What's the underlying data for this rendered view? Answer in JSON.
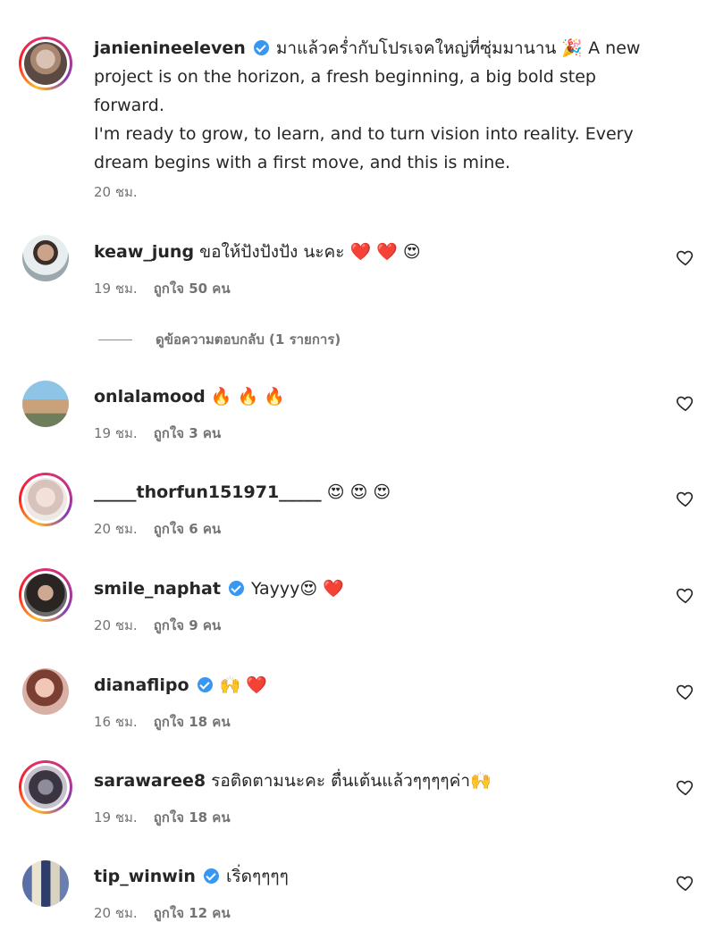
{
  "caption": {
    "username": "janienineeleven",
    "verified": true,
    "text": "มาแล้วคร่ำกับโปรเจคใหญ่ที่ซุ่มมานาน 🎉 A new project is on the horizon, a fresh beginning, a big bold step forward.\nI'm ready to grow, to learn, and to turn vision into reality. Every dream begins with a first move, and this is mine.",
    "time": "20 ชม."
  },
  "view_replies": "ดูข้อความตอบกลับ (1 รายการ)",
  "comments": [
    {
      "username": "keaw_jung",
      "verified": false,
      "text": "ขอให้ปังปังปัง นะคะ ❤️ ❤️ 😍",
      "time": "19 ชม.",
      "likes": "ถูกใจ 50 คน"
    },
    {
      "username": "onlalamood",
      "verified": false,
      "text": "🔥 🔥 🔥",
      "time": "19 ชม.",
      "likes": "ถูกใจ 3 คน"
    },
    {
      "username": "_____thorfun151971_____",
      "verified": false,
      "text": "😍 😍 😍",
      "time": "20 ชม.",
      "likes": "ถูกใจ 6 คน"
    },
    {
      "username": "smile_naphat",
      "verified": true,
      "text": "Yayyy😍 ❤️",
      "time": "20 ชม.",
      "likes": "ถูกใจ 9 คน"
    },
    {
      "username": "dianaflipo",
      "verified": true,
      "text": "🙌 ❤️",
      "time": "16 ชม.",
      "likes": "ถูกใจ 18 คน"
    },
    {
      "username": "sarawaree8",
      "verified": false,
      "text": "รอติดตามนะคะ ตื่นเต้นแล้วๆๆๆๆค่า🙌",
      "time": "19 ชม.",
      "likes": "ถูกใจ 18 คน"
    },
    {
      "username": "tip_winwin",
      "verified": true,
      "text": "เริ่ดๆๆๆๆ",
      "time": "20 ชม.",
      "likes": "ถูกใจ 12 คน"
    }
  ],
  "icons": {
    "like": "heart-outline-icon",
    "verified": "verified-badge-icon"
  },
  "colors": {
    "verified": "#3897f0",
    "muted_text": "#737373",
    "text": "#262626"
  }
}
